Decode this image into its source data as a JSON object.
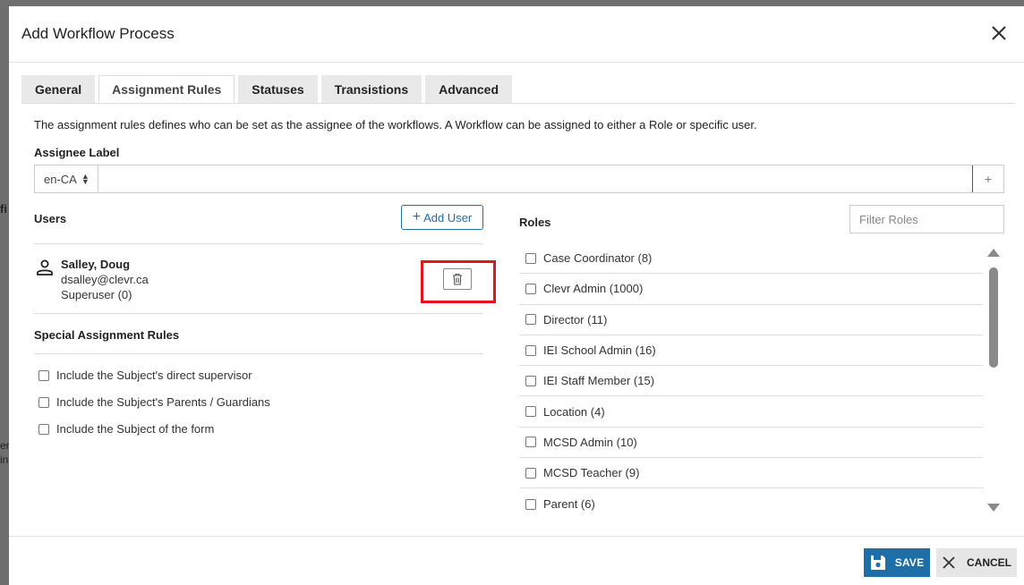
{
  "background": {
    "fragments": [
      "fi",
      "er",
      "in"
    ]
  },
  "modal": {
    "title": "Add Workflow Process"
  },
  "tabs": [
    {
      "label": "General",
      "active": false
    },
    {
      "label": "Assignment Rules",
      "active": true
    },
    {
      "label": "Statuses",
      "active": false
    },
    {
      "label": "Transistions",
      "active": false
    },
    {
      "label": "Advanced",
      "active": false
    }
  ],
  "description": "The assignment rules defines who can be set as the assignee of the workflows. A Workflow can be assigned to either a Role or specific user.",
  "assignee": {
    "label": "Assignee Label",
    "lang": "en-CA",
    "value": "",
    "add_symbol": "+"
  },
  "users": {
    "label": "Users",
    "add_button": "Add User",
    "items": [
      {
        "name": "Salley, Doug",
        "email": "dsalley@clevr.ca",
        "role": "Superuser (0)"
      }
    ]
  },
  "special_rules": {
    "label": "Special Assignment Rules",
    "items": [
      {
        "label": "Include the Subject's direct supervisor",
        "checked": false
      },
      {
        "label": "Include the Subject's Parents / Guardians",
        "checked": false
      },
      {
        "label": "Include the Subject of the form",
        "checked": false
      }
    ]
  },
  "roles": {
    "label": "Roles",
    "filter_placeholder": "Filter Roles",
    "items": [
      {
        "label": "Case Coordinator (8)",
        "checked": false
      },
      {
        "label": "Clevr Admin (1000)",
        "checked": false
      },
      {
        "label": "Director (11)",
        "checked": false
      },
      {
        "label": "IEI School Admin (16)",
        "checked": false
      },
      {
        "label": "IEI Staff Member (15)",
        "checked": false
      },
      {
        "label": "Location (4)",
        "checked": false
      },
      {
        "label": "MCSD Admin (10)",
        "checked": false
      },
      {
        "label": "MCSD Teacher (9)",
        "checked": false
      },
      {
        "label": "Parent (6)",
        "checked": false
      }
    ]
  },
  "footer": {
    "save_label": "SAVE",
    "cancel_label": "CANCEL"
  },
  "colors": {
    "primary": "#1e6fa8",
    "highlight": "#e0161d"
  }
}
